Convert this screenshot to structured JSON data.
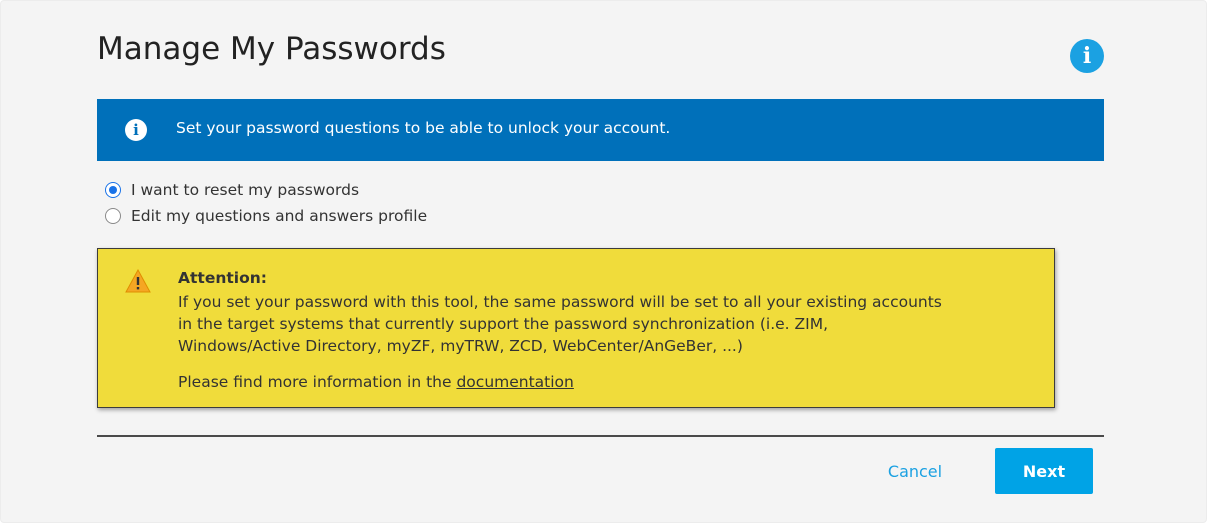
{
  "page": {
    "title": "Manage My Passwords",
    "help_icon": "info-icon"
  },
  "info_banner": {
    "icon": "info-icon",
    "text": "Set your password questions to be able to unlock your account."
  },
  "options": [
    {
      "label": "I want to reset my passwords",
      "selected": true
    },
    {
      "label": "Edit my questions and answers profile",
      "selected": false
    }
  ],
  "attention": {
    "icon": "warning-icon",
    "heading": "Attention:",
    "lines": [
      "If you set your password with this tool, the same password will be set to all your existing accounts",
      "in the target systems that currently support the password synchronization (i.e. ZIM,",
      "Windows/Active Directory, myZF, myTRW, ZCD, WebCenter/AnGeBer, ...)"
    ],
    "more_prefix": "Please find more information in the ",
    "link_text": "documentation"
  },
  "actions": {
    "cancel_label": "Cancel",
    "next_label": "Next"
  },
  "colors": {
    "banner": "#0070ba",
    "accent": "#1ba1e2",
    "primary_button": "#00a3e6",
    "alert_background": "#f0dc3b"
  }
}
